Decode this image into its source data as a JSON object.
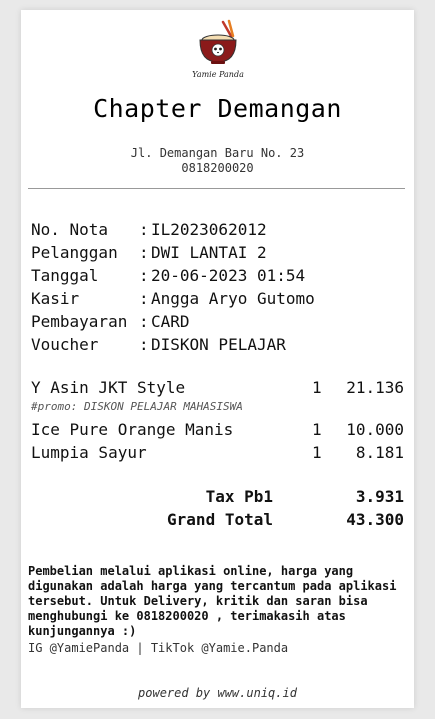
{
  "logo": {
    "text": "Yamie Panda"
  },
  "store": {
    "name": "Chapter Demangan",
    "address": "Jl. Demangan Baru No. 23",
    "phone": "0818200020"
  },
  "info": [
    {
      "label": "No. Nota",
      "value": "IL2023062012"
    },
    {
      "label": "Pelanggan",
      "value": "DWI LANTAI 2"
    },
    {
      "label": "Tanggal",
      "value": "20-06-2023 01:54"
    },
    {
      "label": "Kasir",
      "value": "Angga Aryo Gutomo"
    },
    {
      "label": "Pembayaran",
      "value": "CARD"
    },
    {
      "label": "Voucher",
      "value": "DISKON PELAJAR"
    }
  ],
  "items": [
    {
      "name": "Y Asin JKT Style",
      "qty": "1",
      "price": "21.136",
      "promo": "#promo: DISKON PELAJAR MAHASISWA"
    },
    {
      "name": "Ice Pure Orange Manis",
      "qty": "1",
      "price": "10.000"
    },
    {
      "name": "Lumpia Sayur",
      "qty": "1",
      "price": "8.181"
    }
  ],
  "totals": {
    "tax_label": "Tax Pb1",
    "tax_value": "3.931",
    "grand_label": "Grand Total",
    "grand_value": "43.300"
  },
  "note": "Pembelian melalui aplikasi online, harga yang digunakan adalah harga yang tercantum pada aplikasi tersebut. Untuk Delivery, kritik dan saran bisa menghubungi ke 0818200020 , terimakasih atas kunjungannya :)",
  "social": "IG @YamiePanda | TikTok @Yamie.Panda",
  "footer": {
    "powered": "powered by www.uniq.id"
  },
  "colors": {
    "bowl": "#8b1a1a",
    "chopsticks": "#c0392b",
    "background": "#e9e9e9",
    "paper": "#ffffff"
  }
}
